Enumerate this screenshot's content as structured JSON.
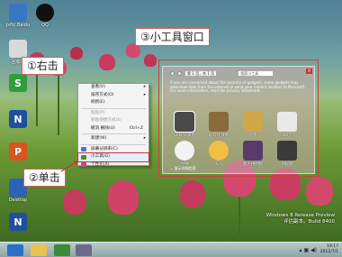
{
  "desktop": {
    "icons": [
      {
        "label": "Jsftc.Baidu",
        "glyph": "",
        "color": "#3a76c4"
      },
      {
        "label": "QQ",
        "glyph": "",
        "color": "#111111"
      },
      {
        "label": "回收站",
        "glyph": "",
        "color": "#d9d9d9"
      },
      {
        "label": "",
        "glyph": "S",
        "color": "#2f9e3a"
      },
      {
        "label": "",
        "glyph": "N",
        "color": "#1e4fa0"
      },
      {
        "label": "",
        "glyph": "P",
        "color": "#d9541e"
      },
      {
        "label": "Desktop",
        "glyph": "",
        "color": "#2b63b8"
      },
      {
        "label": "",
        "glyph": "N",
        "color": "#1e4fa0"
      }
    ]
  },
  "annotations": {
    "step1": "①右击",
    "step2": "②单击",
    "step3": "③小工具窗口"
  },
  "context_menu": {
    "items": [
      {
        "label": "查看(V)",
        "arrow": "▸",
        "shortcut": "",
        "disabled": false
      },
      {
        "label": "排序方式(O)",
        "arrow": "▸",
        "shortcut": "",
        "disabled": false
      },
      {
        "label": "刷新(E)",
        "arrow": "",
        "shortcut": "",
        "disabled": false
      },
      {
        "label": "粘贴(P)",
        "arrow": "",
        "shortcut": "",
        "disabled": true
      },
      {
        "label": "粘贴快捷方式(S)",
        "arrow": "",
        "shortcut": "",
        "disabled": true
      },
      {
        "label": "撤消 删除(U)",
        "arrow": "",
        "shortcut": "Ctrl+Z",
        "disabled": false
      },
      {
        "label": "新建(W)",
        "arrow": "▸",
        "shortcut": "",
        "disabled": false
      },
      {
        "label": "屏幕分辨率(C)",
        "arrow": "",
        "shortcut": "",
        "disabled": false
      },
      {
        "label": "小工具(G)",
        "arrow": "",
        "shortcut": "",
        "disabled": false
      },
      {
        "label": "个性化(R)",
        "arrow": "",
        "shortcut": "",
        "disabled": false
      }
    ]
  },
  "gadget_window": {
    "page": "第 1 页，共 1 页",
    "search_placeholder": "搜索小工具",
    "info_text": "If you are concerned about the security of gadgets, some gadgets may download data from the internet or send your current location to Microsoft. For more information, read the privacy statement.",
    "gadgets": [
      {
        "name": "CPU 仪表盘",
        "color": "#4a4a4a",
        "selected": true
      },
      {
        "name": "幻灯片放映",
        "color": "#8a6a3a",
        "selected": false
      },
      {
        "name": "货币",
        "color": "#d0a84a",
        "selected": false
      },
      {
        "name": "日历",
        "color": "#e8e8e8",
        "selected": false
      },
      {
        "name": "时钟",
        "color": "#f2f2f2",
        "selected": false
      },
      {
        "name": "天气",
        "color": "#f0c040",
        "selected": false
      },
      {
        "name": "图片拼图板",
        "color": "#5a3a6a",
        "selected": false
      },
      {
        "name": "源标题",
        "color": "#3a3a3a",
        "selected": false
      }
    ],
    "details_label": "显示详细信息"
  },
  "watermark": {
    "line1": "Windows 8 Release Preview",
    "line2": "评估副本。Build 8400"
  },
  "taskbar": {
    "time": "19:17",
    "date": "2012/7/1",
    "tray_icons": "▴ ▣ ◀)"
  }
}
